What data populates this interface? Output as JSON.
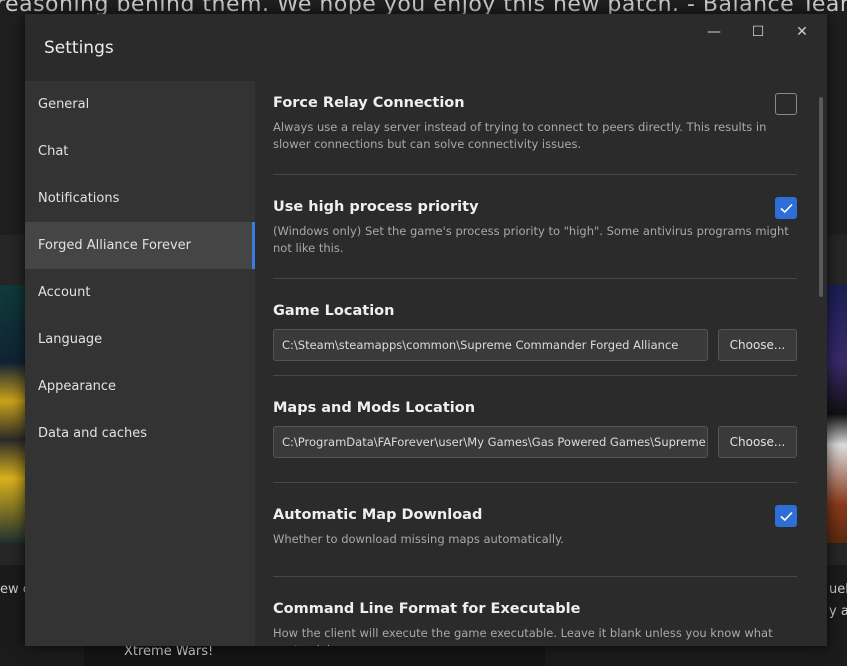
{
  "background": {
    "news_text": "reasoning behind them. We hope you enjoy this new patch. - Balance Team",
    "snippet_left": "ew c",
    "snippet_right_1": "ueli",
    "snippet_right_2": "y at",
    "bottom_card_title": "Xtreme Wars!"
  },
  "window": {
    "title": "Settings",
    "minimize_symbol": "—",
    "maximize_symbol": "☐",
    "close_symbol": "✕"
  },
  "sidebar": {
    "items": [
      {
        "label": "General",
        "active": false
      },
      {
        "label": "Chat",
        "active": false
      },
      {
        "label": "Notifications",
        "active": false
      },
      {
        "label": "Forged Alliance Forever",
        "active": true
      },
      {
        "label": "Account",
        "active": false
      },
      {
        "label": "Language",
        "active": false
      },
      {
        "label": "Appearance",
        "active": false
      },
      {
        "label": "Data and caches",
        "active": false
      }
    ]
  },
  "settings": {
    "force_relay": {
      "title": "Force Relay Connection",
      "description": "Always use a relay server instead of trying to connect to peers directly. This results in slower connections but can solve connectivity issues.",
      "checked": false
    },
    "high_priority": {
      "title": "Use high process priority",
      "description": "(Windows only) Set the game's process priority to \"high\". Some antivirus programs might not like this.",
      "checked": true
    },
    "game_location": {
      "title": "Game Location",
      "value": "C:\\Steam\\steamapps\\common\\Supreme Commander Forged Alliance",
      "button": "Choose..."
    },
    "maps_mods_location": {
      "title": "Maps and Mods Location",
      "value": "C:\\ProgramData\\FAForever\\user\\My Games\\Gas Powered Games\\Supreme Commander Forged Alliance",
      "button": "Choose..."
    },
    "auto_map_download": {
      "title": "Automatic Map Download",
      "description": "Whether to download missing maps automatically.",
      "checked": true
    },
    "command_line_format": {
      "title": "Command Line Format for Executable",
      "description": "How the client will execute the game executable. Leave it blank unless you know what you're doing."
    }
  },
  "colors": {
    "accent": "#2d6fd6",
    "active_indicator": "#3a7be0",
    "dialog_bg": "#2b2b2b",
    "sidebar_bg": "#333333"
  }
}
